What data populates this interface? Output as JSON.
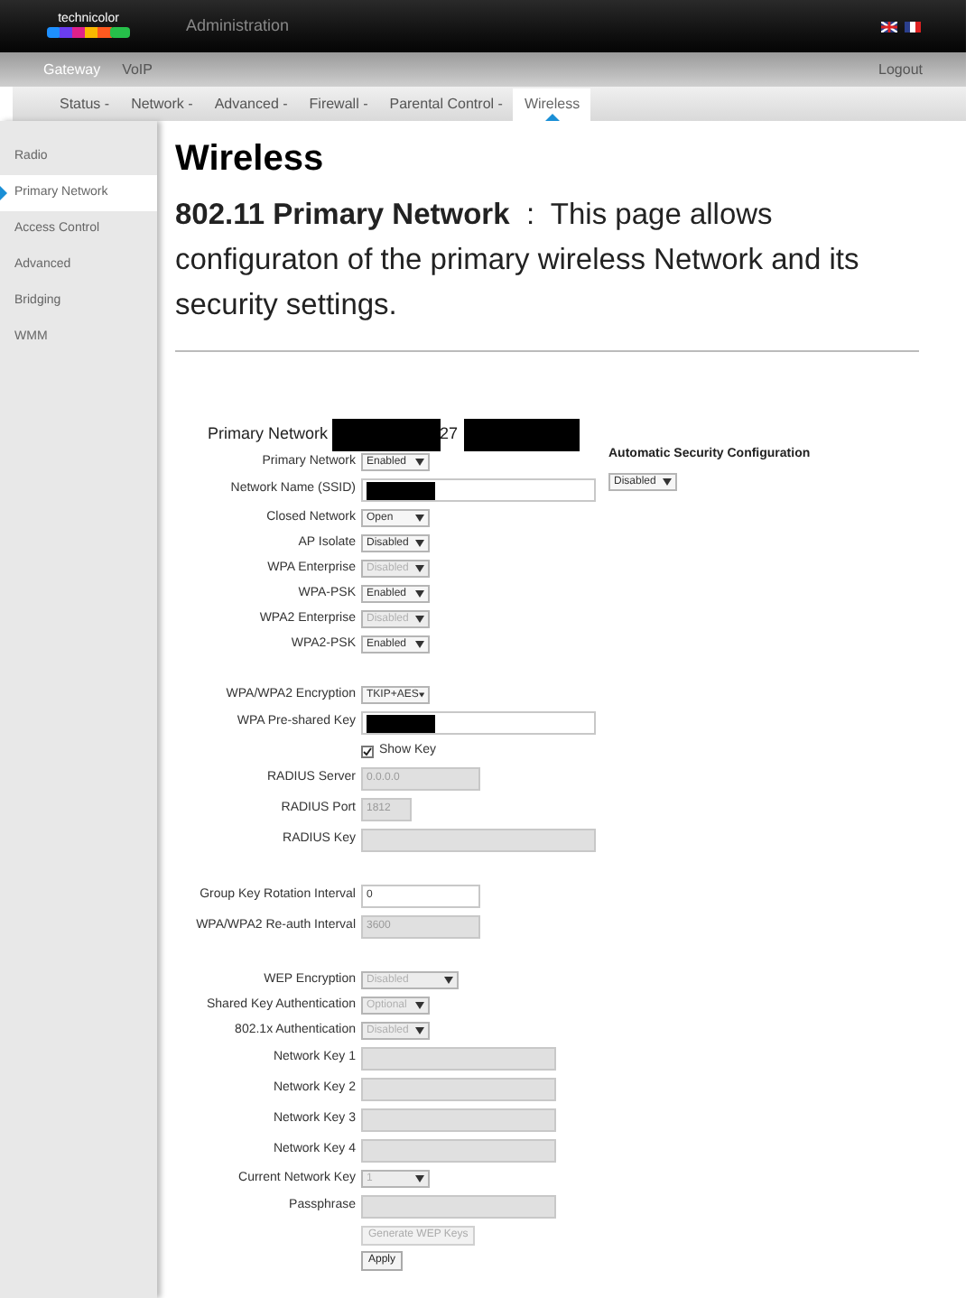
{
  "header": {
    "logo": "technicolor",
    "title": "Administration"
  },
  "top_nav": [
    {
      "label": "Gateway",
      "selected": true
    },
    {
      "label": "VoIP",
      "selected": false
    }
  ],
  "logout": "Logout",
  "tabs": [
    {
      "label": "Status -",
      "selected": false
    },
    {
      "label": "Network -",
      "selected": false
    },
    {
      "label": "Advanced -",
      "selected": false
    },
    {
      "label": "Firewall -",
      "selected": false
    },
    {
      "label": "Parental Control -",
      "selected": false
    },
    {
      "label": "Wireless",
      "selected": true
    }
  ],
  "sidebar": {
    "items": [
      {
        "label": "Radio",
        "selected": false
      },
      {
        "label": "Primary Network",
        "selected": true
      },
      {
        "label": "Access Control",
        "selected": false
      },
      {
        "label": "Advanced",
        "selected": false
      },
      {
        "label": "Bridging",
        "selected": false
      },
      {
        "label": "WMM",
        "selected": false
      }
    ]
  },
  "page_title": "Wireless",
  "description": "**802.11 Primary Network**  :  This page allows configuraton of the primary wireless Network and its security settings.",
  "form": {
    "title_parts": [
      {
        "kind": "text",
        "text": "Primary Network"
      },
      {
        "kind": "redacted"
      },
      {
        "kind": "text",
        "text": "27"
      },
      {
        "kind": "redacted"
      }
    ],
    "auto_security": {
      "label": "Automatic Security Configuration",
      "value": "Disabled"
    },
    "rows": [
      {
        "kind": "select",
        "label": "Primary Network",
        "value": "Enabled",
        "disabled": false
      },
      {
        "kind": "input",
        "label": "Network Name (SSID)",
        "redacted": true,
        "disabled": false
      },
      {
        "kind": "select",
        "label": "Closed Network",
        "value": "Open",
        "disabled": false
      },
      {
        "kind": "select",
        "label": "AP Isolate",
        "value": "Disabled",
        "disabled": false
      },
      {
        "kind": "select",
        "label": "WPA Enterprise",
        "value": "Disabled",
        "disabled": true
      },
      {
        "kind": "select",
        "label": "WPA-PSK",
        "value": "Enabled",
        "disabled": false
      },
      {
        "kind": "select",
        "label": "WPA2 Enterprise",
        "value": "Disabled",
        "disabled": true
      },
      {
        "kind": "select",
        "label": "WPA2-PSK",
        "value": "Enabled",
        "disabled": false
      },
      {
        "kind": "gap"
      },
      {
        "kind": "select",
        "label": "WPA/WPA2 Encryption",
        "value": "TKIP+AES",
        "disabled": false
      },
      {
        "kind": "input",
        "label": "WPA Pre-shared Key",
        "redacted": true,
        "disabled": false
      },
      {
        "kind": "checkbox",
        "label": "Show Key",
        "checked": true
      },
      {
        "kind": "input",
        "label": "RADIUS Server",
        "value": "0.0.0.0",
        "disabled": true
      },
      {
        "kind": "input",
        "label": "RADIUS Port",
        "value": "1812",
        "disabled": true
      },
      {
        "kind": "input",
        "label": "RADIUS Key",
        "disabled": true
      },
      {
        "kind": "gap"
      },
      {
        "kind": "input",
        "label": "Group Key Rotation Interval",
        "value": "0",
        "disabled": false
      },
      {
        "kind": "input",
        "label": "WPA/WPA2 Re-auth Interval",
        "value": "3600",
        "disabled": true
      },
      {
        "kind": "gap"
      },
      {
        "kind": "select",
        "label": "WEP Encryption",
        "value": "Disabled",
        "disabled": true
      },
      {
        "kind": "select",
        "label": "Shared Key Authentication",
        "value": "Optional",
        "disabled": true
      },
      {
        "kind": "select",
        "label": "802.1x Authentication",
        "value": "Disabled",
        "disabled": true
      },
      {
        "kind": "input",
        "label": "Network Key 1",
        "disabled": true
      },
      {
        "kind": "input",
        "label": "Network Key 2",
        "disabled": true
      },
      {
        "kind": "input",
        "label": "Network Key 3",
        "disabled": true
      },
      {
        "kind": "input",
        "label": "Network Key 4",
        "disabled": true
      },
      {
        "kind": "select",
        "label": "Current Network Key",
        "value": "1",
        "disabled": true
      },
      {
        "kind": "input",
        "label": "Passphrase",
        "disabled": true
      },
      {
        "kind": "button",
        "label": "Generate WEP Keys",
        "disabled": true
      },
      {
        "kind": "button",
        "label": "Apply",
        "disabled": false
      }
    ]
  }
}
